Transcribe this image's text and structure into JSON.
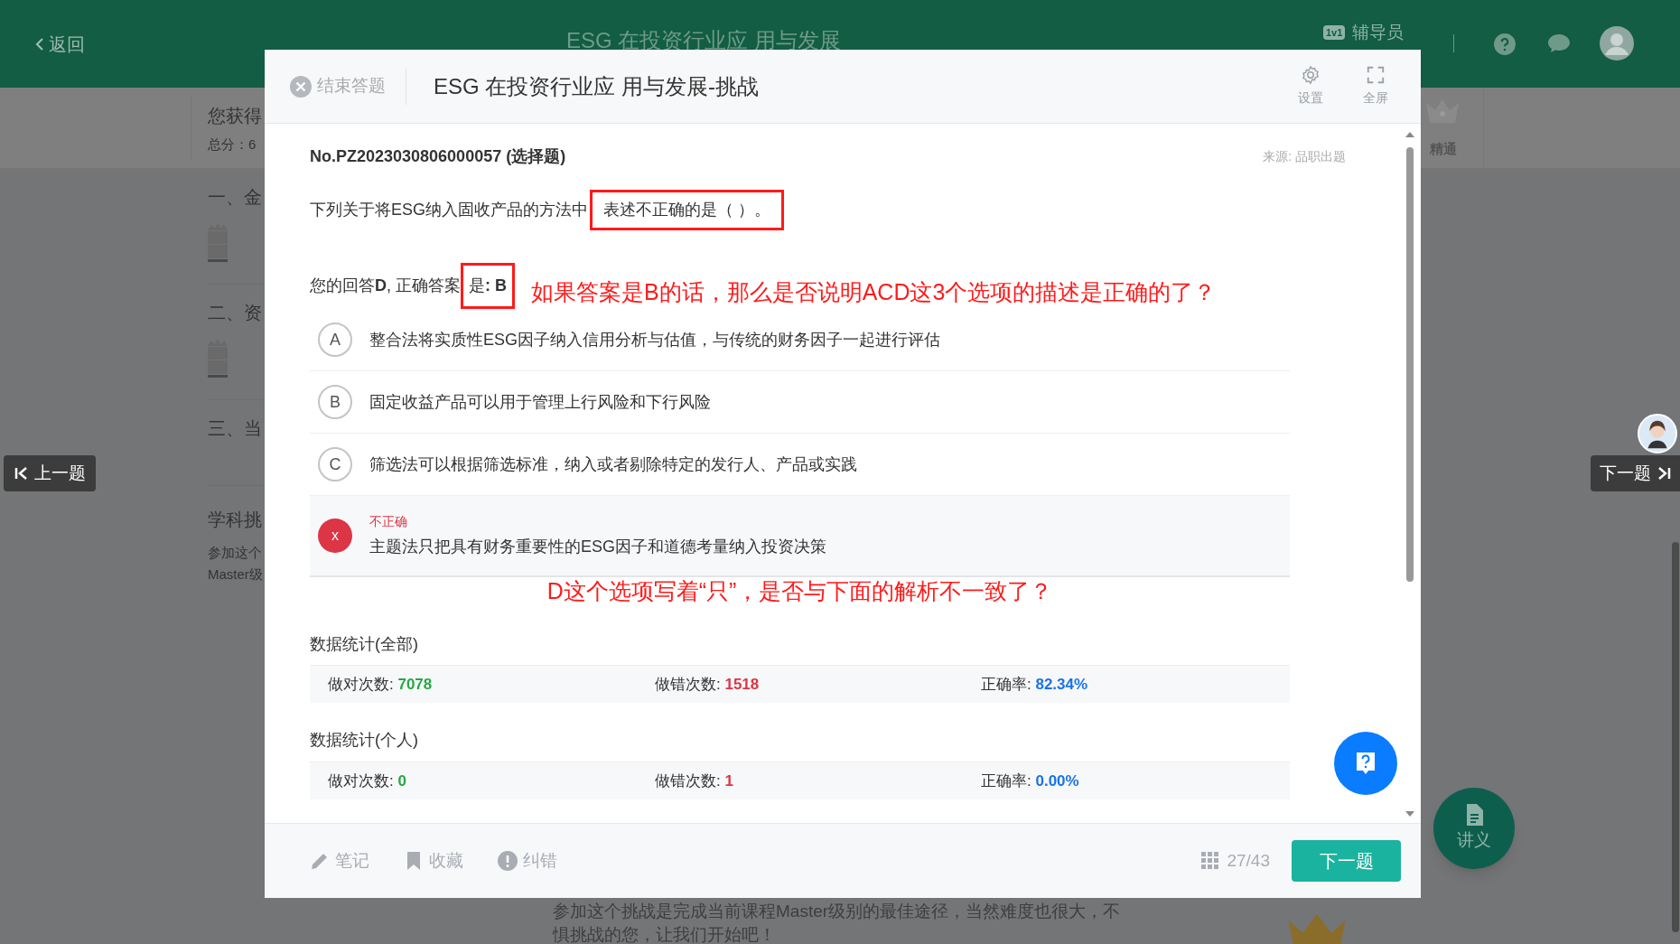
{
  "page_header": {
    "back": "返回",
    "title": "ESG 在投资行业应 用与发展",
    "tutor_badge": "1v1",
    "tutor": "辅导员"
  },
  "summary": {
    "heading": "您获得",
    "score": "总分：6",
    "level_label": "精通"
  },
  "chapters": [
    {
      "title": "一、金",
      "trophy": true
    },
    {
      "title": "二、资",
      "trophy": true
    },
    {
      "title": "三、当",
      "trophy": false
    }
  ],
  "challenge_card": {
    "title": "学科挑",
    "lines": [
      "参加这个",
      "Master级"
    ]
  },
  "challenge_intro": [
    "参加这个挑战是完成当前课程Master级别的最佳途径，当然难度也很大，不",
    "惧挑战的您，让我们开始吧！"
  ],
  "side_nav": {
    "prev": "上一题",
    "next": "下一题"
  },
  "handout_button": "讲义",
  "quiz": {
    "end_button": "结束答题",
    "title": "ESG 在投资行业应 用与发展-挑战",
    "tools": [
      {
        "kind": "settings",
        "label": "设置"
      },
      {
        "kind": "fullscreen",
        "label": "全屏"
      }
    ],
    "question_id": "No.PZ2023030806000057 (选择题)",
    "source": "来源: 品职出题",
    "stem": "下列关于将ESG纳入固收产品的方法中",
    "stem_highlighted": "表述不正确的是（ ）。",
    "answer": "您的回答**D**, 正确答案",
    "answer_highlighted": "是**: B**",
    "annotations": [
      "如果答案是B的话，那么是否说明ACD这3个选项的描述是正确的了？",
      "D这个选项写着“只”，是否与下面的解析不一致了？"
    ],
    "options": [
      {
        "marker": "A",
        "text": "整合法将实质性ESG因子纳入信用分析与估值，与传统的财务因子一起进行评估",
        "incorrect": false
      },
      {
        "marker": "B",
        "text": "固定收益产品可以用于管理上行风险和下行风险",
        "incorrect": false
      },
      {
        "marker": "C",
        "text": "筛选法可以根据筛选标准，纳入或者剔除特定的发行人、产品或实践",
        "incorrect": false
      },
      {
        "marker": "x",
        "text": "主题法只把具有财务重要性的ESG因子和道德考量纳入投资决策",
        "incorrect": true,
        "result_label": "不正确"
      }
    ],
    "stats": [
      {
        "title": "数据统计(全部)",
        "items": [
          {
            "kind": "correct",
            "label": "做对次数:",
            "value": "7078"
          },
          {
            "kind": "wrong",
            "label": "做错次数:",
            "value": "1518"
          },
          {
            "kind": "rate",
            "label": "正确率:",
            "value": "82.34%"
          }
        ]
      },
      {
        "title": "数据统计(个人)",
        "items": [
          {
            "kind": "correct",
            "label": "做对次数:",
            "value": "0"
          },
          {
            "kind": "wrong",
            "label": "做错次数:",
            "value": "1"
          },
          {
            "kind": "rate",
            "label": "正确率:",
            "value": "0.00%"
          }
        ]
      }
    ],
    "footer_actions": [
      {
        "kind": "note",
        "label": "笔记"
      },
      {
        "kind": "bookmark",
        "label": "收藏"
      },
      {
        "kind": "report",
        "label": "纠错"
      }
    ],
    "progress": "27/43",
    "next_button": "下一题"
  }
}
